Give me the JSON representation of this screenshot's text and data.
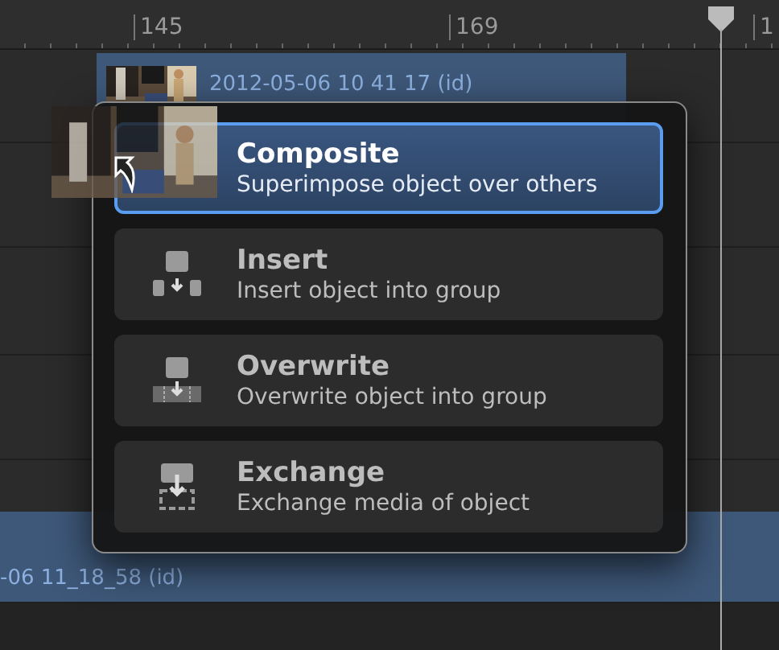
{
  "ruler": {
    "labels": [
      "145",
      "169",
      "1"
    ]
  },
  "clips": [
    {
      "title": "2012-05-06 10 41 17 (id)"
    },
    {
      "title": "-06 11_18_58 (id)"
    }
  ],
  "drop_menu": {
    "items": [
      {
        "kind": "composite",
        "title": "Composite",
        "subtitle": "Superimpose object over others",
        "selected": true
      },
      {
        "kind": "insert",
        "title": "Insert",
        "subtitle": "Insert object into group",
        "selected": false
      },
      {
        "kind": "overwrite",
        "title": "Overwrite",
        "subtitle": "Overwrite object into group",
        "selected": false
      },
      {
        "kind": "exchange",
        "title": "Exchange",
        "subtitle": "Exchange media of object",
        "selected": false
      }
    ]
  }
}
